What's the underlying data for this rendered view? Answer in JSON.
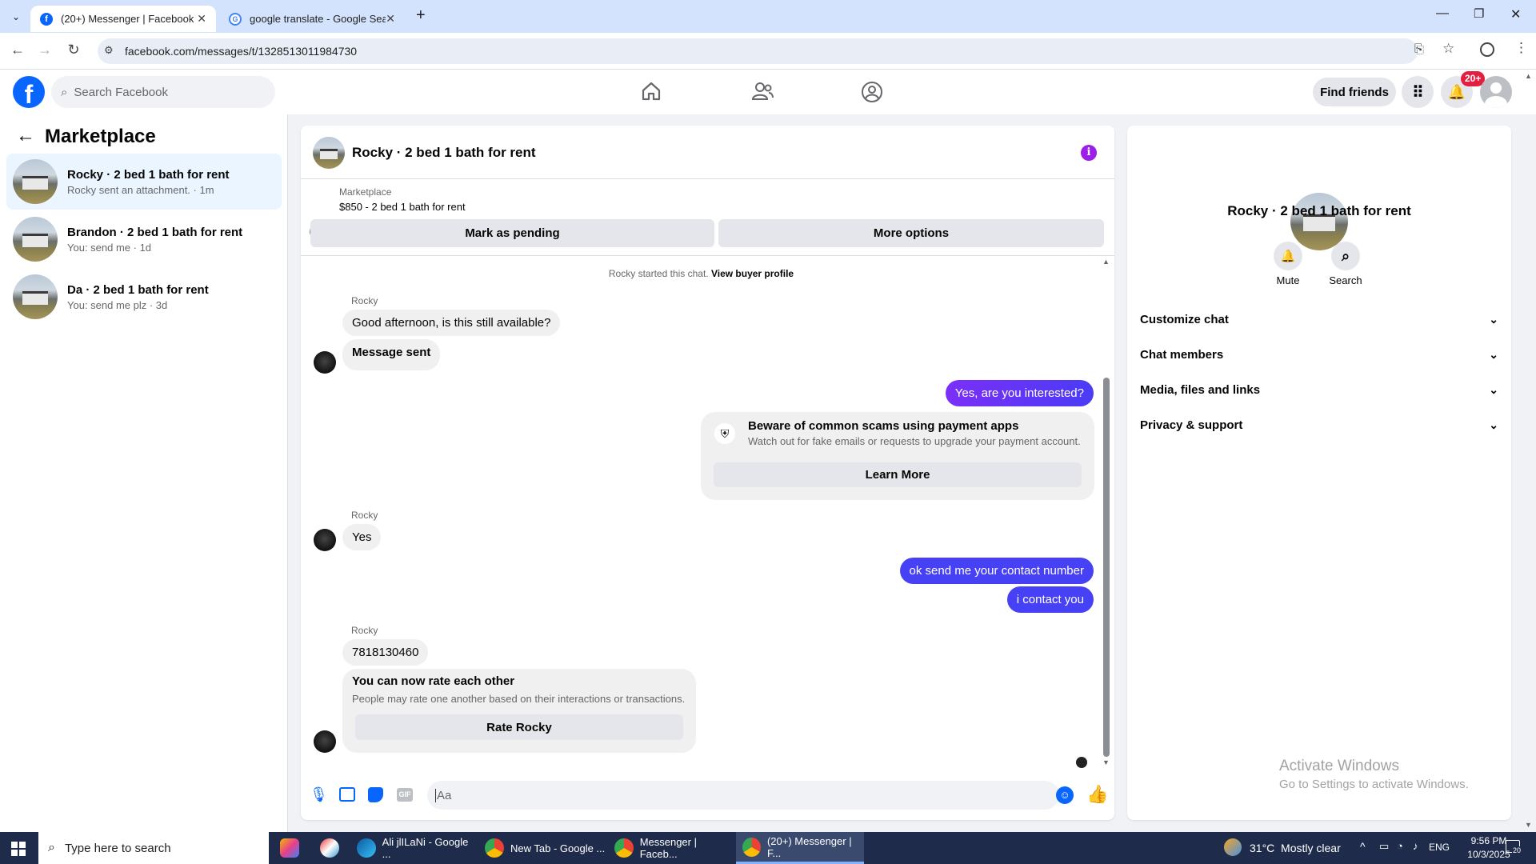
{
  "browser": {
    "tabs": [
      {
        "title": "(20+) Messenger | Facebook",
        "active": true
      },
      {
        "title": "google translate - Google Search",
        "active": false
      }
    ],
    "url": "facebook.com/messages/t/1328513011984730"
  },
  "header": {
    "search_placeholder": "Search Facebook",
    "find_friends": "Find friends",
    "notif_badge": "20+"
  },
  "left": {
    "title": "Marketplace",
    "conversations": [
      {
        "name": "Rocky · 2 bed 1 bath for rent",
        "preview": "Rocky sent an attachment. · 1m"
      },
      {
        "name": "Brandon · 2 bed 1 bath for rent",
        "preview": "You: send me · 1d"
      },
      {
        "name": "Da · 2 bed 1 bath for rent",
        "preview": "You: send me plz · 3d"
      }
    ]
  },
  "chat": {
    "title": "Rocky · 2 bed 1 bath for rent",
    "listing_source": "Marketplace",
    "listing_desc": "$850 - 2 bed 1 bath for rent",
    "mark_pending": "Mark as pending",
    "more_options": "More options",
    "started_text": "Rocky started this chat.",
    "view_profile": "View buyer profile",
    "sender": "Rocky",
    "m1": "Good afternoon, is this still available?",
    "m2": "Message sent",
    "m3": "Yes, are you interested?",
    "scam_title": "Beware of common scams using payment apps",
    "scam_sub": "Watch out for fake emails or requests to upgrade your payment account.",
    "learn_more": "Learn More",
    "m4": "Yes",
    "m5": "ok send me your contact number",
    "m6": "i contact you",
    "m7": "7818130460",
    "rate_title": "You can now rate each other",
    "rate_sub": "People may rate one another based on their interactions or transactions.",
    "rate_btn": "Rate Rocky",
    "input_placeholder": "Aa"
  },
  "right": {
    "name": "Rocky · 2 bed 1 bath for rent",
    "mute": "Mute",
    "search": "Search",
    "sections": [
      "Customize chat",
      "Chat members",
      "Media, files and links",
      "Privacy & support"
    ],
    "watermark_title": "Activate Windows",
    "watermark_sub": "Go to Settings to activate Windows."
  },
  "taskbar": {
    "search_placeholder": "Type here to search",
    "apps": [
      "Ali jlILaNi - Google ...",
      "New Tab - Google ...",
      "Messenger | Faceb...",
      "(20+) Messenger | F..."
    ],
    "weather": "31°C  Mostly clear",
    "lang": "ENG",
    "time": "9:56 PM",
    "date": "10/3/2025",
    "notif_count": "20"
  },
  "colors": {
    "fb_blue": "#0866ff",
    "purple_accent": "#7b2ff7",
    "outgoing_blue": "#4741f5"
  }
}
